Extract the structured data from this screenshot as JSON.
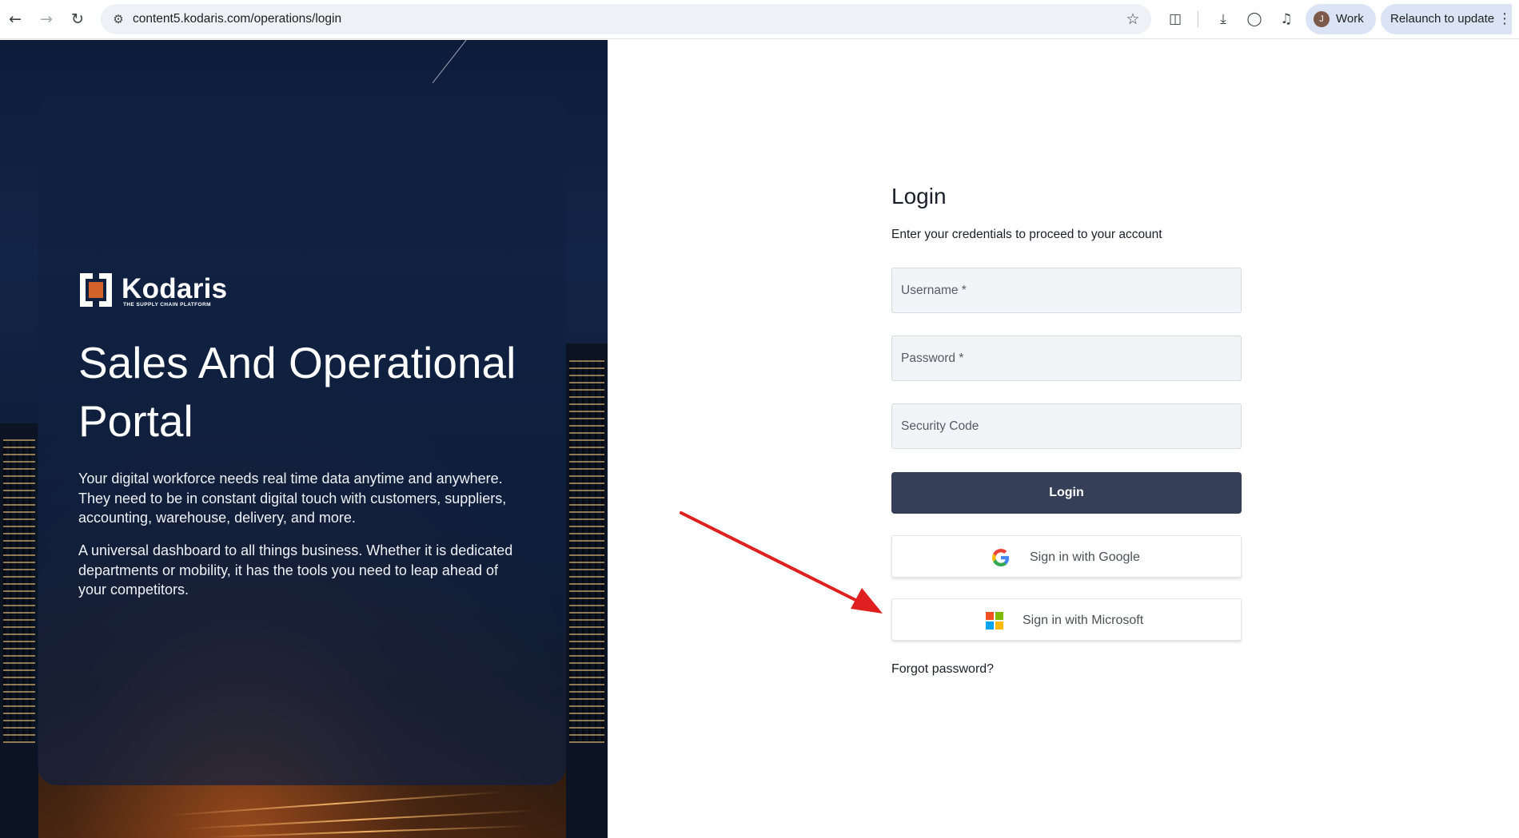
{
  "browser": {
    "url": "content5.kodaris.com/operations/login",
    "profile_initial": "J",
    "profile_label": "Work",
    "relaunch_label": "Relaunch to update"
  },
  "hero": {
    "logo_text": "Kodaris",
    "logo_tagline": "THE SUPPLY CHAIN PLATFORM",
    "title": "Sales And Operational Portal",
    "paragraph1": "Your digital workforce needs real time data anytime and anywhere. They need to be in constant digital touch with customers, suppliers, accounting, warehouse, delivery, and more.",
    "paragraph2": "A universal dashboard to all things business. Whether it is dedicated departments or mobility, it has the tools you need to leap ahead of your competitors."
  },
  "login": {
    "title": "Login",
    "subtitle": "Enter your credentials to proceed to your account",
    "username_placeholder": "Username *",
    "password_placeholder": "Password *",
    "security_code_placeholder": "Security Code",
    "login_button": "Login",
    "google_button": "Sign in with Google",
    "microsoft_button": "Sign in with Microsoft",
    "forgot_password": "Forgot password?"
  },
  "colors": {
    "login_button_bg": "#363f58",
    "annotation_arrow": "#e02020",
    "brand_orange": "#d2612a"
  },
  "icons": [
    "back-arrow-icon",
    "forward-arrow-icon",
    "reload-icon",
    "site-info-icon",
    "bookmark-star-icon",
    "reading-mode-icon",
    "download-icon",
    "extensions-icon",
    "media-control-icon",
    "kebab-menu-icon",
    "google-logo-icon",
    "microsoft-logo-icon"
  ]
}
